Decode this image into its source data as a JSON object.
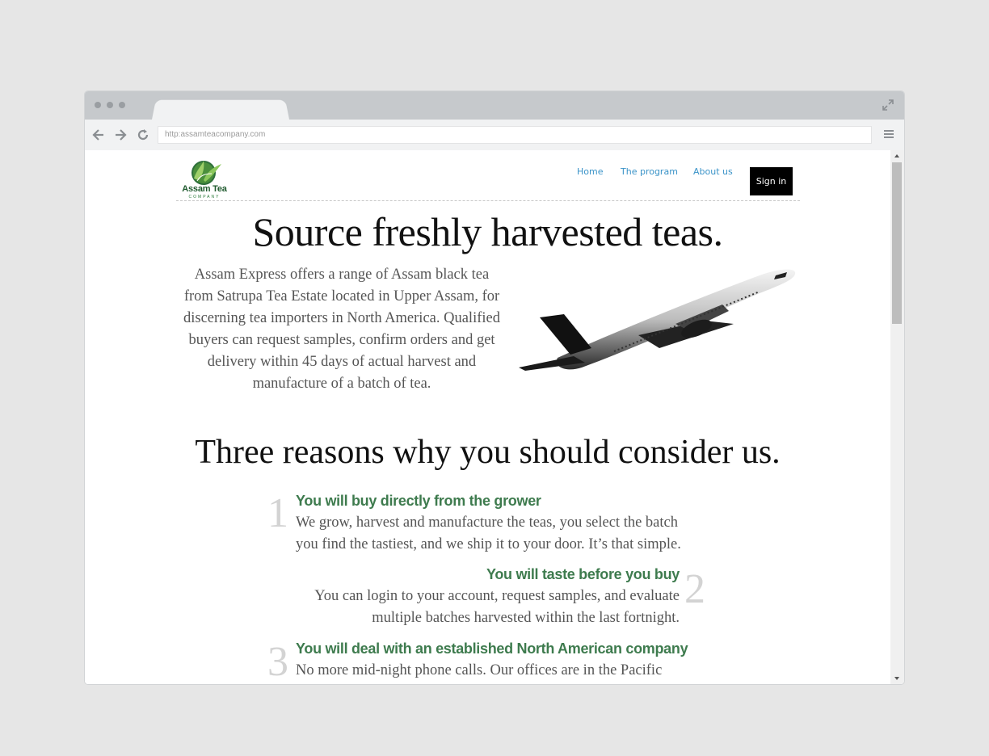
{
  "browser": {
    "url": "http:assamteacompany.com"
  },
  "site": {
    "logo_name": "Assam Tea",
    "logo_sub": "COMPANY"
  },
  "nav": {
    "home": "Home",
    "program": "The program",
    "about": "About us",
    "signin": "Sign in"
  },
  "hero": {
    "title": "Source freshly harvested teas.",
    "lines": [
      "Assam Express offers a range of Assam black tea",
      "from Satrupa Tea Estate located in Upper Assam, for",
      "discerning tea importers in North America. Qualified",
      "buyers can request samples, confirm orders and get",
      "delivery within 45 days of actual harvest and",
      "manufacture of a batch of tea."
    ]
  },
  "reasons": {
    "title": "Three reasons why you should consider us.",
    "items": [
      {
        "number": "1",
        "heading": "You will buy directly from the grower",
        "lines": [
          "We grow, harvest and manufacture the teas, you select the batch",
          "you find the tastiest, and we ship it to your door. It’s that simple."
        ]
      },
      {
        "number": "2",
        "heading": "You will taste before you buy",
        "lines": [
          "You can login to your account, request samples, and evaluate",
          "multiple batches harvested within the last fortnight."
        ]
      },
      {
        "number": "3",
        "heading": "You will deal with an established North American company",
        "lines": [
          "No more mid-night phone calls. Our offices are in the Pacific"
        ]
      }
    ]
  },
  "colors": {
    "accent_green": "#3e7b4e",
    "link_blue": "#3a93c8",
    "signin_bg": "#000000"
  }
}
